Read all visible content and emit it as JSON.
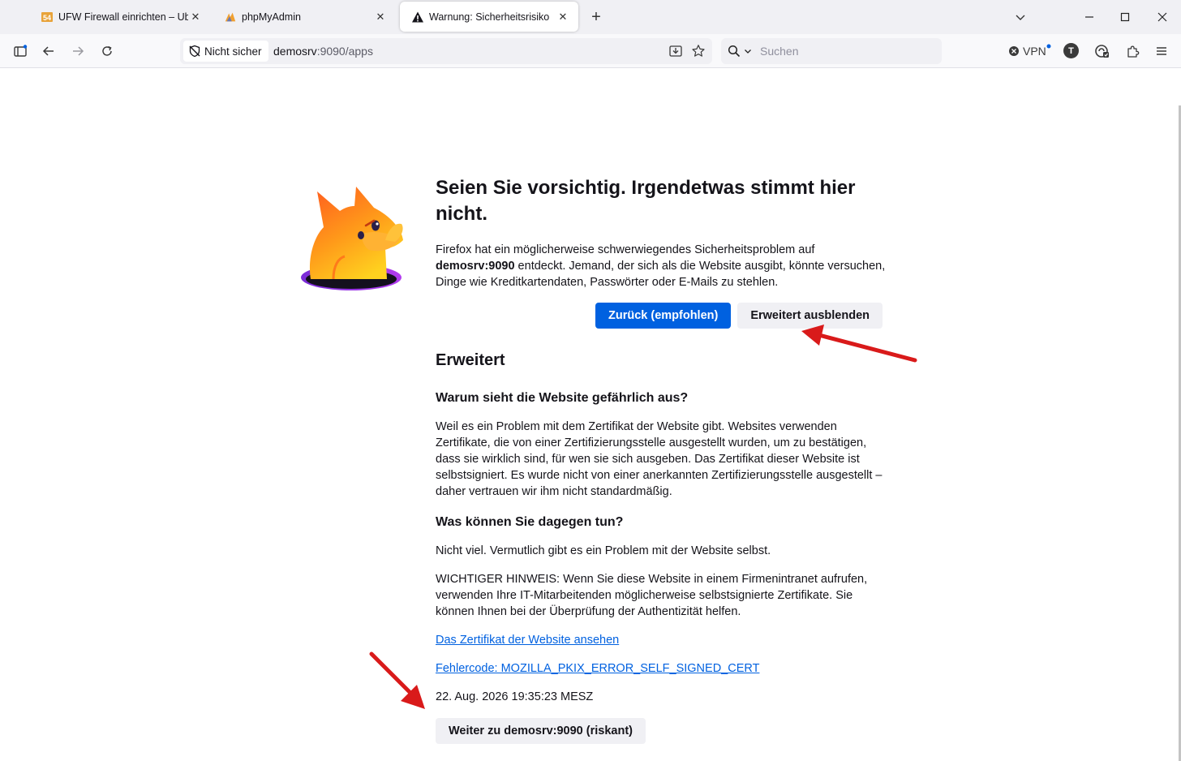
{
  "tabs": [
    {
      "title": "UFW Firewall einrichten – Ubuntu",
      "favicon": "ufw-favicon",
      "active": false
    },
    {
      "title": "phpMyAdmin",
      "favicon": "phpmyadmin-favicon",
      "active": false
    },
    {
      "title": "Warnung: Sicherheitsrisiko",
      "favicon": "warning-icon",
      "active": true
    }
  ],
  "navbar": {
    "security_label": "Nicht sicher",
    "url_host": "demosrv",
    "url_path": ":9090/apps",
    "search_placeholder": "Suchen",
    "vpn_label": "VPN",
    "account_initial": "T"
  },
  "error_page": {
    "title": "Seien Sie vorsichtig. Irgendetwas stimmt hier nicht.",
    "intro_before": "Firefox hat ein möglicherweise schwerwiegendes Sicherheitsproblem auf ",
    "intro_host": "demosrv:9090",
    "intro_after": " entdeckt. Jemand, der sich als die Website ausgibt, könnte versuchen, Dinge wie Kreditkartendaten, Passwörter oder E-Mails zu stehlen.",
    "back_button": "Zurück (empfohlen)",
    "advanced_button": "Erweitert ausblenden",
    "advanced_heading": "Erweitert",
    "why_heading": "Warum sieht die Website gefährlich aus?",
    "why_text": "Weil es ein Problem mit dem Zertifikat der Website gibt. Websites verwenden Zertifikate, die von einer Zertifizierungsstelle ausgestellt wurden, um zu bestätigen, dass sie wirklich sind, für wen sie sich ausgeben. Das Zertifikat dieser Website ist selbstsigniert. Es wurde nicht von einer anerkannten Zertifizierungsstelle ausgestellt – daher vertrauen wir ihm nicht standardmäßig.",
    "what_heading": "Was können Sie dagegen tun?",
    "what_text": "Nicht viel. Vermutlich gibt es ein Problem mit der Website selbst.",
    "notice_text": "WICHTIGER HINWEIS: Wenn Sie diese Website in einem Firmenintranet aufrufen, verwenden Ihre IT-Mitarbeitenden möglicherweise selbstsignierte Zertifikate. Sie können Ihnen bei der Überprüfung der Authentizität helfen.",
    "view_cert_link": "Das Zertifikat der Website ansehen",
    "error_code_link": "Fehlercode: MOZILLA_PKIX_ERROR_SELF_SIGNED_CERT",
    "timestamp": "22. Aug. 2026 19:35:23 MESZ",
    "continue_button": "Weiter zu demosrv:9090 (riskant)"
  },
  "colors": {
    "accent": "#0061e0",
    "annotation_arrow": "#d91a1a"
  }
}
